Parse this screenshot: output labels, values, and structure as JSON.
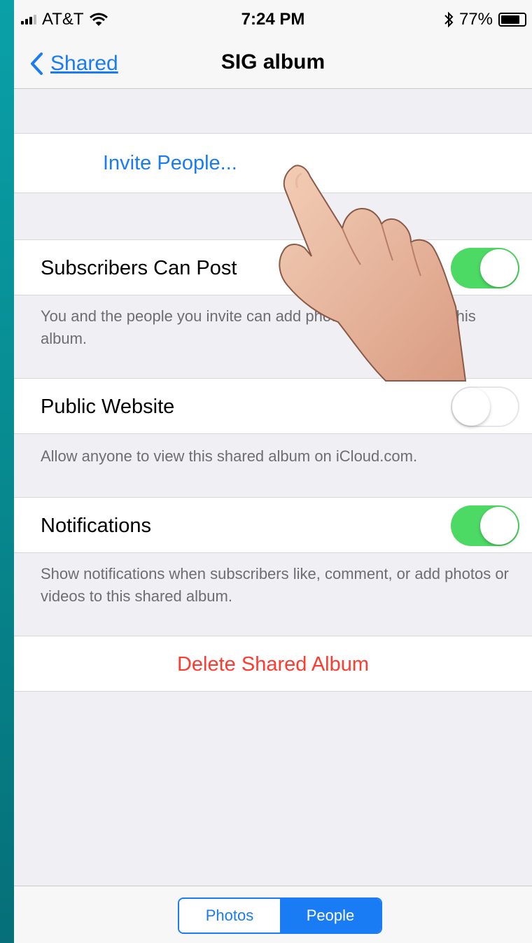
{
  "status_bar": {
    "carrier": "AT&T",
    "time": "7:24 PM",
    "battery": "77%",
    "battery_level": 0.77
  },
  "nav": {
    "back_label": "Shared",
    "title": "SIG album"
  },
  "invite": {
    "label": "Invite People..."
  },
  "subscribers_can_post": {
    "label": "Subscribers Can Post",
    "enabled": true,
    "footer": "You and the people you invite can add photos and videos to this album."
  },
  "public_website": {
    "label": "Public Website",
    "enabled": false,
    "footer": "Allow anyone to view this shared album on iCloud.com."
  },
  "notifications": {
    "label": "Notifications",
    "enabled": true,
    "footer": "Show notifications when subscribers like, comment, or add photos or videos to this shared album."
  },
  "delete": {
    "label": "Delete Shared Album"
  },
  "segment": {
    "photos": "Photos",
    "people": "People",
    "selected": "People"
  },
  "colors": {
    "accent": "#1a7cf5",
    "toggle_on": "#4cd964",
    "destructive": "#ff3b30",
    "background": "#efeff4"
  }
}
